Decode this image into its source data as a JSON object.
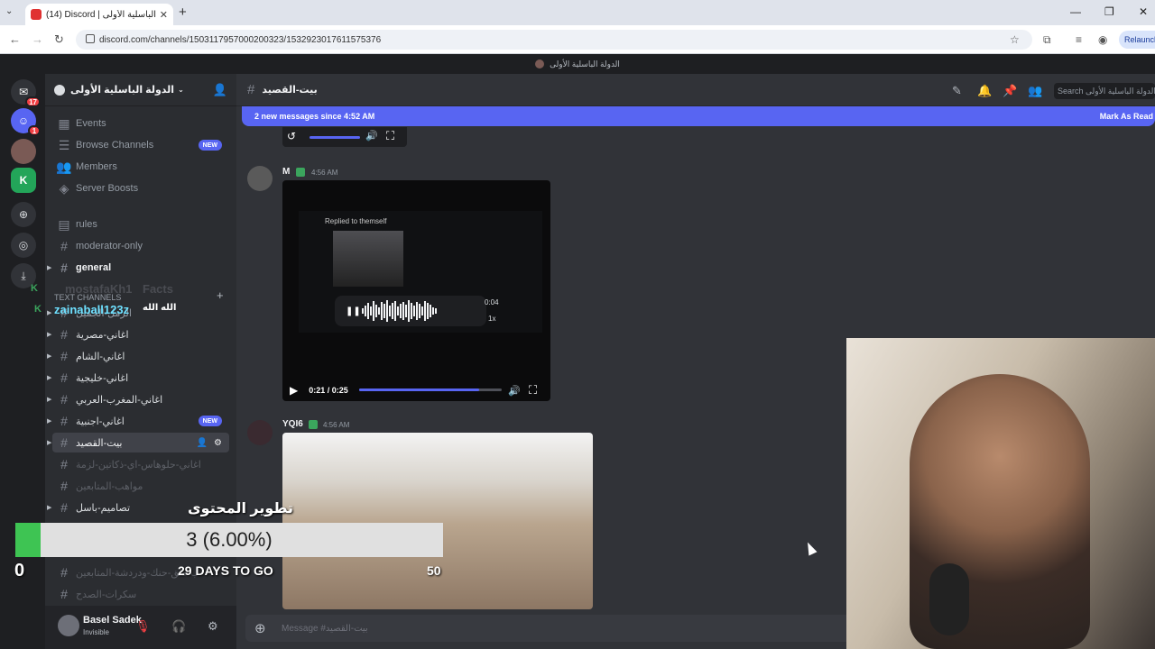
{
  "browser": {
    "tab_title": "(14) Discord | الدولة الباسلية الأولى #",
    "url": "discord.com/channels/1503117957000200323/1532923017611575376",
    "relaunch_label": "Relaunch"
  },
  "app_topbar": {
    "title": "الدولة الباسلية الأولى"
  },
  "guilds": {
    "badges": [
      "17",
      "1"
    ]
  },
  "server": {
    "name": "الدولة الباسلية الأولى",
    "top_items": [
      "Events",
      "Browse Channels",
      "Members",
      "Server Boosts"
    ],
    "new_badge": "NEW",
    "category_label": "Text Channels",
    "channels": [
      "rules",
      "moderator-only",
      "general",
      "الرمل-الجميل",
      "اغاني-مصرية",
      "اغاني-الشام",
      "اغاني-خليجية",
      "اغاني-المغرب-العربي",
      "اغاني-اجنبية",
      "بيت-القصيد",
      "اغاني-حلوهاس-اي-ذكاتين-لزمة",
      "مواهب-المتابعين",
      "تصاميم-باسل",
      "ب-طق-حنك-ودردشة-المتابعين",
      "سكرات-الصدح"
    ]
  },
  "user": {
    "name": "Basel Sadek",
    "status": "Invisible"
  },
  "channel": {
    "name": "بيت-القصيد",
    "search_placeholder": "Search الدولة الباسلية الأولى",
    "banner": "2 new messages since 4:52 AM",
    "banner_action": "Mark As Read",
    "message_placeholder": "Message #بيت-القصيد"
  },
  "messages": [
    {
      "author": "M",
      "time": "4:56 AM",
      "video": {
        "replied_label": "Replied to themself",
        "audio_time": "0:04",
        "audio_speed": "1x",
        "time_label": "0:21 / 0:25",
        "progress": 0.84
      }
    },
    {
      "author": "YQI6",
      "time": "4:56 AM"
    }
  ],
  "stream_overlay": {
    "alert1_user": "mostafaKh1",
    "alert1_text": "Facts",
    "alert2_user": "zainaball123z",
    "alert2_text": "الله الله",
    "goal_title": "تطوير المحتوى",
    "goal_text": "3 (6.00%)",
    "goal_fraction": 0.06,
    "goal_min": "0",
    "goal_days": "29 DAYS TO GO",
    "goal_max": "50"
  },
  "colors": {
    "discord_blurple": "#5865f2",
    "goal_green": "#3ec453",
    "verified_green": "#3ba55d"
  }
}
